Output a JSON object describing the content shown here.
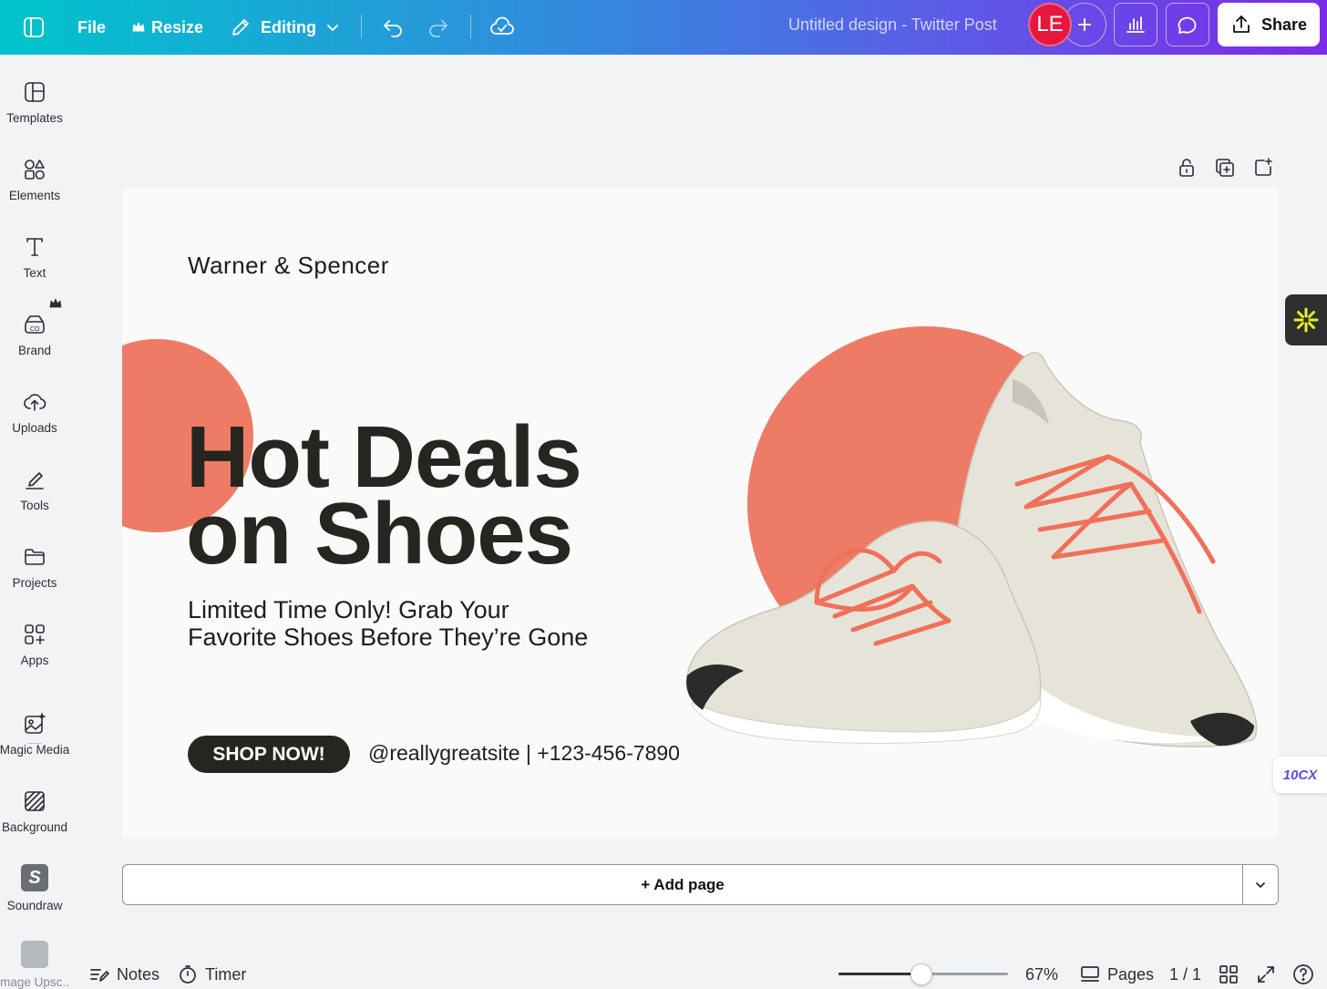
{
  "topbar": {
    "file_label": "File",
    "resize_label": "Resize",
    "editing_label": "Editing",
    "doc_title": "Untitled design - Twitter Post",
    "avatar_initials": "LE",
    "share_label": "Share",
    "avatar_color": "#e5173f"
  },
  "sidebar": {
    "items": [
      {
        "label": "Templates",
        "icon": "templates-icon"
      },
      {
        "label": "Elements",
        "icon": "elements-icon"
      },
      {
        "label": "Text",
        "icon": "text-icon"
      },
      {
        "label": "Brand",
        "icon": "brand-icon"
      },
      {
        "label": "Uploads",
        "icon": "uploads-icon"
      },
      {
        "label": "Tools",
        "icon": "tools-icon"
      },
      {
        "label": "Projects",
        "icon": "projects-icon"
      },
      {
        "label": "Apps",
        "icon": "apps-icon"
      },
      {
        "label": "Magic Media",
        "icon": "magic-media-icon"
      },
      {
        "label": "Background",
        "icon": "background-icon"
      },
      {
        "label": "Soundraw",
        "icon": "soundraw-icon"
      },
      {
        "label": "Image Upsc...",
        "icon": "image-upscaler-icon"
      }
    ]
  },
  "design": {
    "brand_name": "Warner & Spencer",
    "headline_line1": "Hot Deals",
    "headline_line2": "on Shoes",
    "subline": "Limited Time Only! Grab Your Favorite Shoes Before They’re Gone",
    "cta_label": "SHOP NOW!",
    "contact": "@reallygreatsite | +123-456-7890",
    "accent_color": "#ee7b66",
    "dark_color": "#262520"
  },
  "side_widget2_label": "10CX",
  "add_page_label": "+ Add page",
  "bottombar": {
    "notes_label": "Notes",
    "timer_label": "Timer",
    "zoom_label": "67%",
    "zoom_fraction": 0.49,
    "pages_label": "Pages",
    "page_count": "1 / 1"
  }
}
